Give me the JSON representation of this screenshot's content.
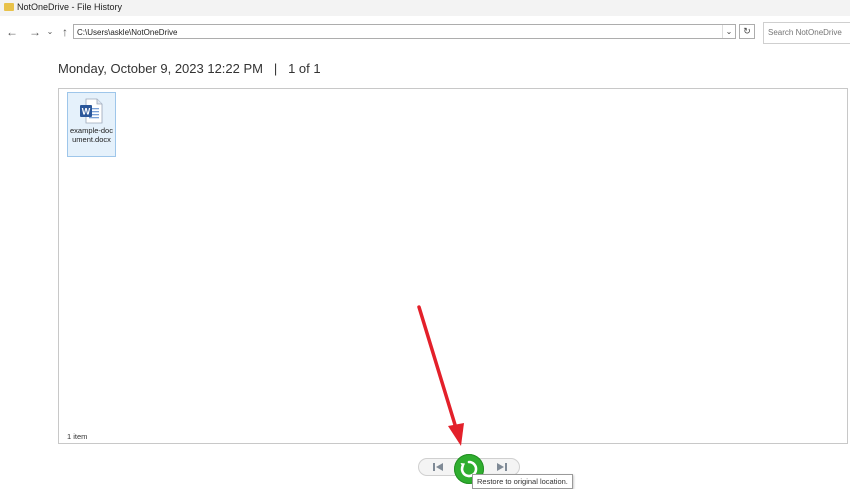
{
  "window": {
    "title": "NotOneDrive - File History"
  },
  "nav": {
    "address": "C:\\Users\\askle\\NotOneDrive",
    "search_placeholder": "Search NotOneDrive"
  },
  "header": {
    "date": "Monday, October 9, 2023 12:22 PM",
    "separator": "|",
    "page": "1 of 1"
  },
  "files": [
    {
      "name": "example-document.docx",
      "type_icon": "word-document-icon"
    }
  ],
  "status": {
    "count": "1 item"
  },
  "playback": {
    "tooltip": "Restore to original location."
  },
  "colors": {
    "restore_green": "#2fae2f",
    "annotation_arrow": "#e3202a",
    "word_blue": "#2b579a"
  }
}
